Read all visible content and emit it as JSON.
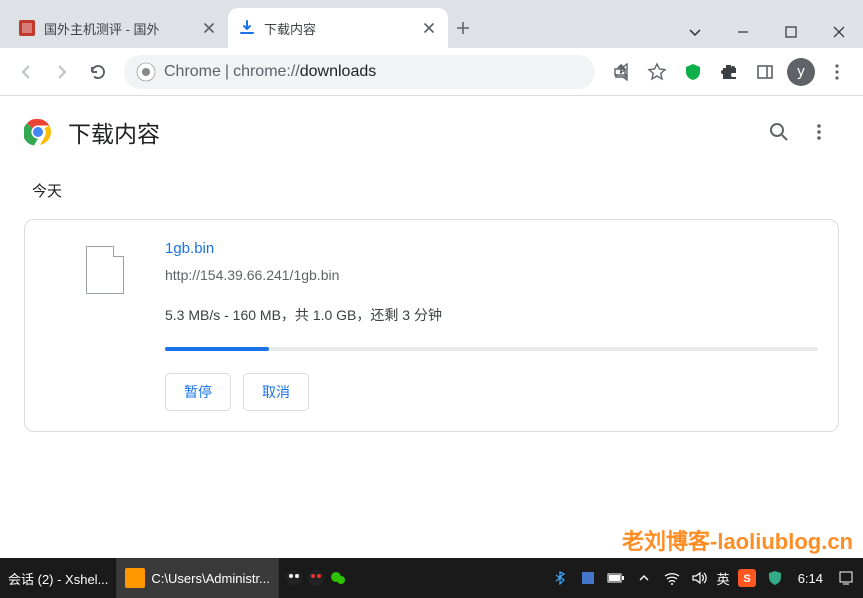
{
  "tabs": [
    {
      "title": "国外主机测评 - 国外",
      "favicon_color": "#c0392b"
    },
    {
      "title": "下载内容",
      "favicon_type": "download"
    }
  ],
  "omnibox": {
    "prefix": "Chrome",
    "sep": " | ",
    "url_greyed": "chrome://",
    "url_dark": "downloads"
  },
  "toolbar": {
    "avatar_letter": "y"
  },
  "page": {
    "title": "下载内容",
    "section": "今天"
  },
  "download": {
    "filename": "1gb.bin",
    "url": "http://154.39.66.241/1gb.bin",
    "status": "5.3 MB/s - 160 MB，共 1.0 GB，还剩 3 分钟",
    "progress_percent": 16,
    "pause_label": "暂停",
    "cancel_label": "取消"
  },
  "taskbar": {
    "items": [
      {
        "label": "会话 (2) - Xshel..."
      },
      {
        "label": "C:\\Users\\Administr..."
      }
    ],
    "ime": "英",
    "time": "6:14"
  },
  "watermark": "老刘博客-laoliublog.cn"
}
